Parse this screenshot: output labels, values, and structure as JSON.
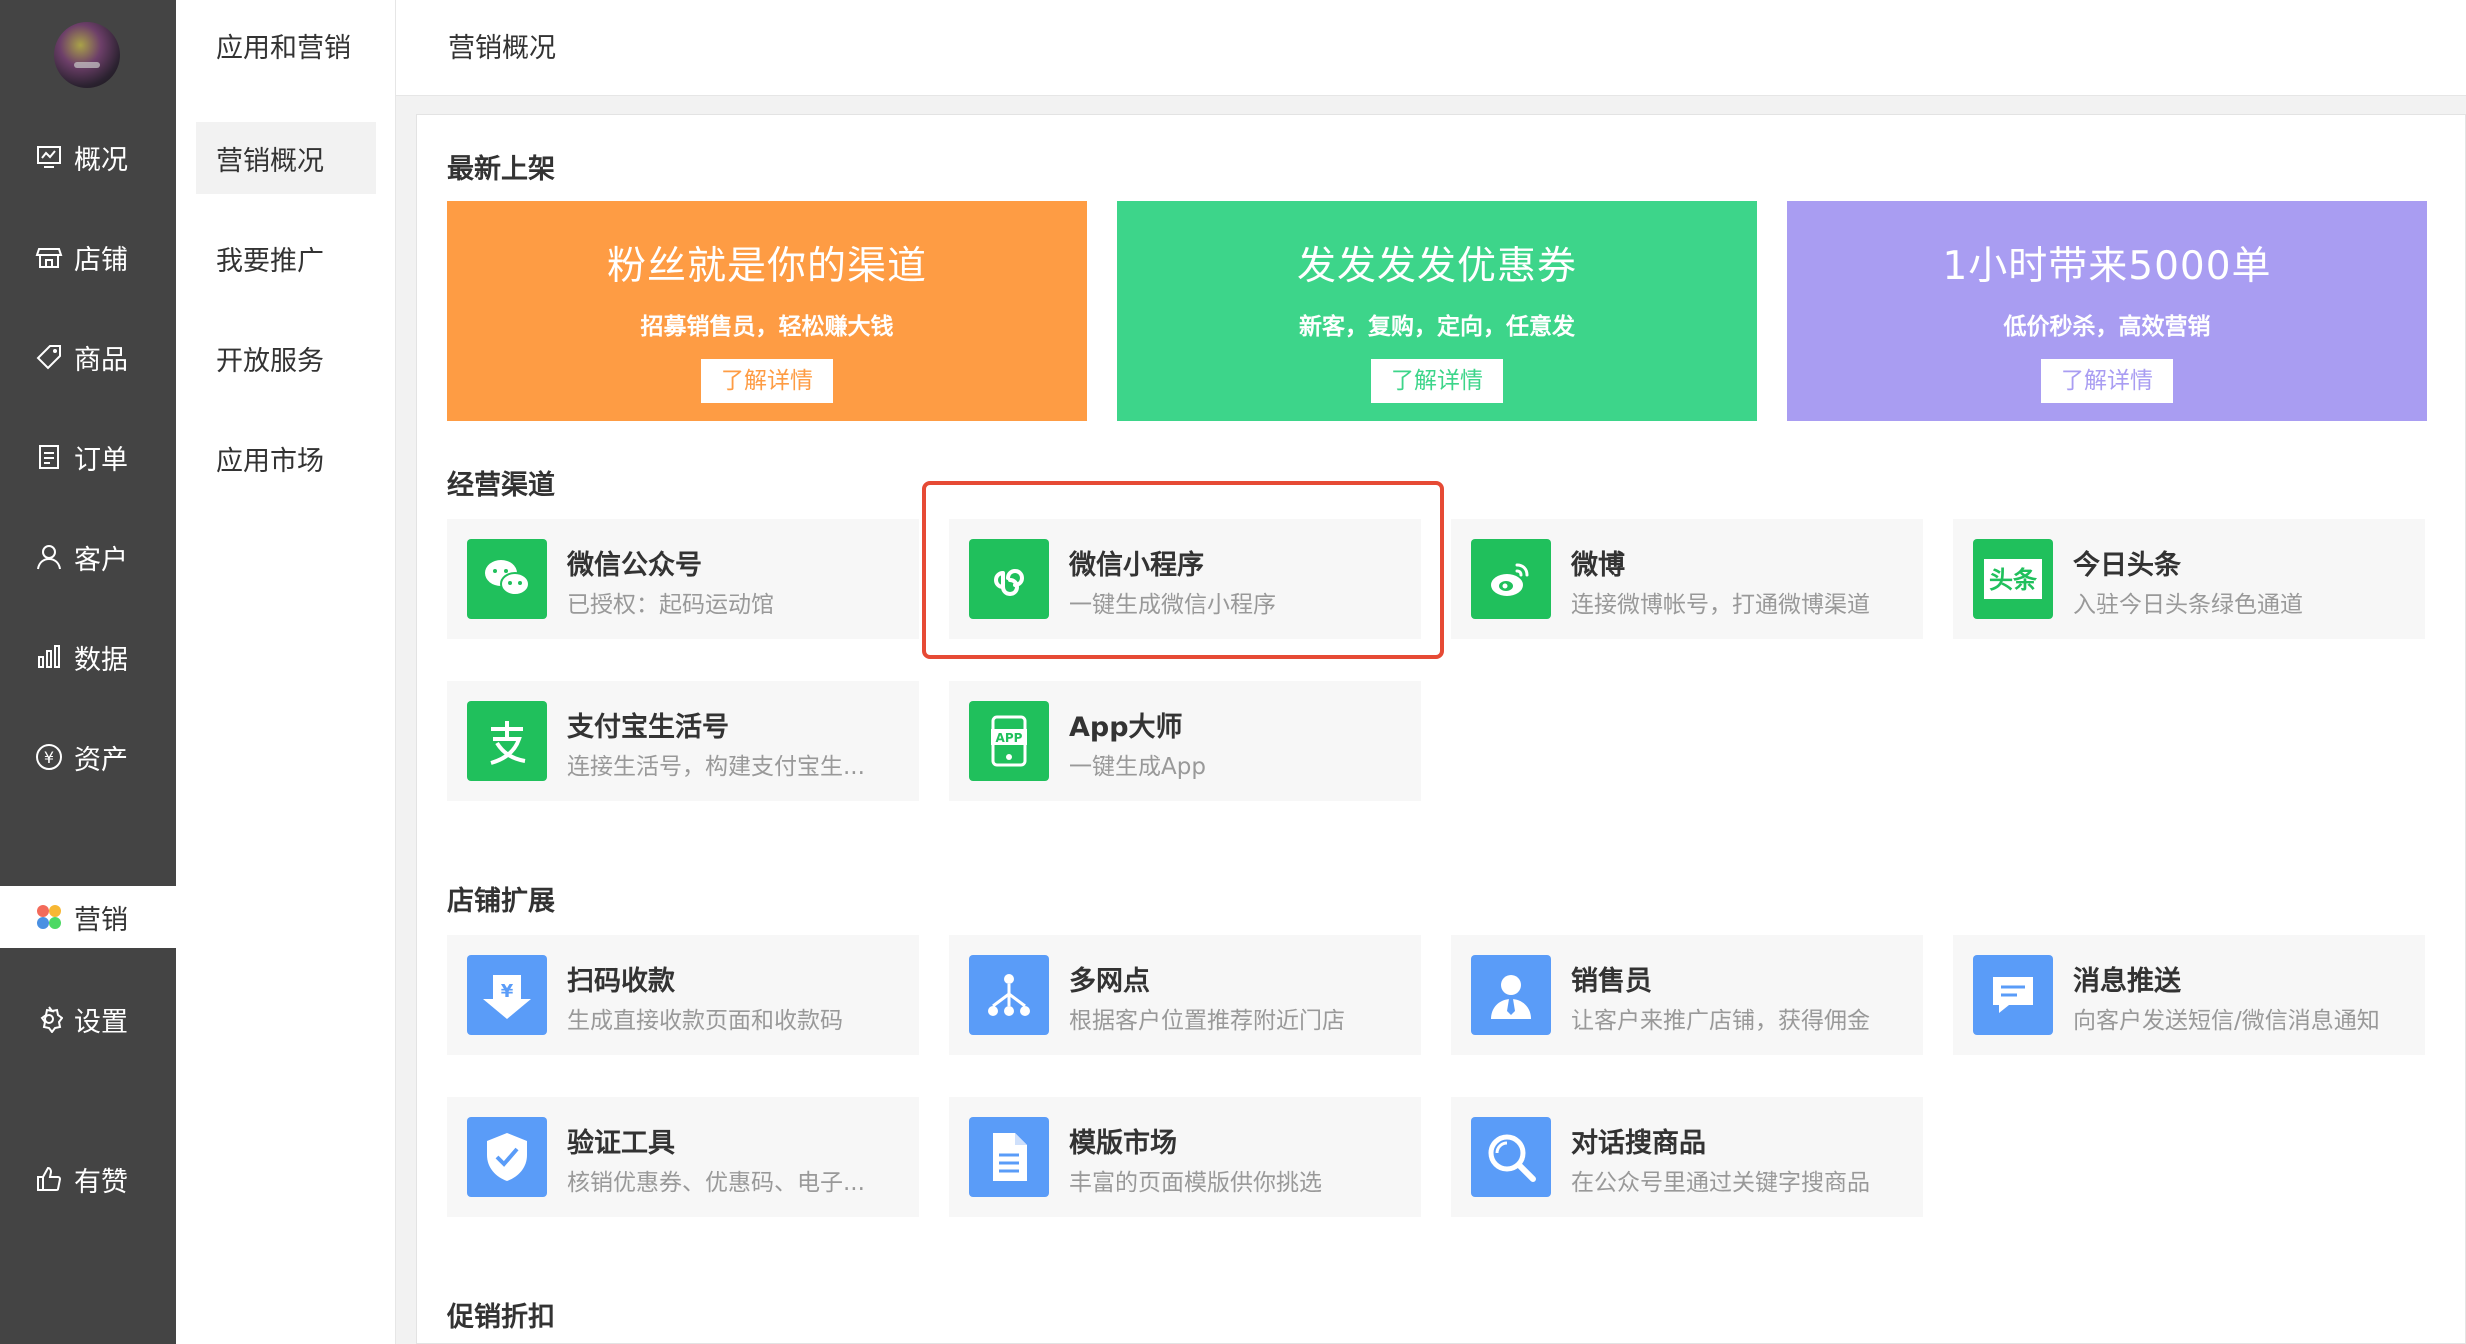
{
  "sidebar": {
    "items": [
      {
        "label": "概况",
        "icon": "overview-icon"
      },
      {
        "label": "店铺",
        "icon": "store-icon"
      },
      {
        "label": "商品",
        "icon": "tag-icon"
      },
      {
        "label": "订单",
        "icon": "order-icon"
      },
      {
        "label": "客户",
        "icon": "user-icon"
      },
      {
        "label": "数据",
        "icon": "chart-icon"
      },
      {
        "label": "资产",
        "icon": "yen-icon"
      },
      {
        "label": "营销",
        "icon": "marketing-icon"
      },
      {
        "label": "设置",
        "icon": "gear-icon"
      },
      {
        "label": "有赞",
        "icon": "thumb-up-icon"
      }
    ]
  },
  "subnav": {
    "title": "应用和营销",
    "items": [
      "营销概况",
      "我要推广",
      "开放服务",
      "应用市场"
    ]
  },
  "header": {
    "title": "营销概况"
  },
  "sections": {
    "new": "最新上架",
    "channels": "经营渠道",
    "expand": "店铺扩展",
    "promo": "促销折扣"
  },
  "banners": [
    {
      "title": "粉丝就是你的渠道",
      "sub": "招募销售员，轻松赚大钱",
      "btn": "了解详情",
      "color": "#fe9c44"
    },
    {
      "title": "发发发发优惠券",
      "sub": "新客，复购，定向，任意发",
      "btn": "了解详情",
      "color": "#3dd58a"
    },
    {
      "title": "1小时带来5000单",
      "sub": "低价秒杀，高效营销",
      "btn": "了解详情",
      "color": "#a99df2"
    }
  ],
  "channels": [
    {
      "name": "微信公众号",
      "desc": "已授权：起码运动馆",
      "icon": "wechat-icon"
    },
    {
      "name": "微信小程序",
      "desc": "一键生成微信小程序",
      "icon": "mini-program-icon"
    },
    {
      "name": "微博",
      "desc": "连接微博帐号，打通微博渠道",
      "icon": "weibo-icon"
    },
    {
      "name": "今日头条",
      "desc": "入驻今日头条绿色通道",
      "icon": "toutiao-icon"
    },
    {
      "name": "支付宝生活号",
      "desc": "连接生活号，构建支付宝生...",
      "icon": "alipay-icon"
    },
    {
      "name": "App大师",
      "desc": "一键生成App",
      "icon": "app-icon"
    }
  ],
  "expand": [
    {
      "name": "扫码收款",
      "desc": "生成直接收款页面和收款码",
      "icon": "qr-payment-icon"
    },
    {
      "name": "多网点",
      "desc": "根据客户位置推荐附近门店",
      "icon": "network-icon"
    },
    {
      "name": "销售员",
      "desc": "让客户来推广店铺，获得佣金",
      "icon": "salesperson-icon"
    },
    {
      "name": "消息推送",
      "desc": "向客户发送短信/微信消息通知",
      "icon": "message-icon"
    },
    {
      "name": "验证工具",
      "desc": "核销优惠券、优惠码、电子...",
      "icon": "shield-check-icon"
    },
    {
      "name": "模版市场",
      "desc": "丰富的页面模版供你挑选",
      "icon": "document-icon"
    },
    {
      "name": "对话搜商品",
      "desc": "在公众号里通过关键字搜商品",
      "icon": "search-icon"
    }
  ],
  "icon_text": {
    "toutiao": "头条",
    "app": "APP",
    "yen": "¥"
  },
  "colors": {
    "sidebar": "#444444",
    "green": "#20c05c",
    "blue": "#5a9cf8",
    "highlight": "#e64a35"
  }
}
